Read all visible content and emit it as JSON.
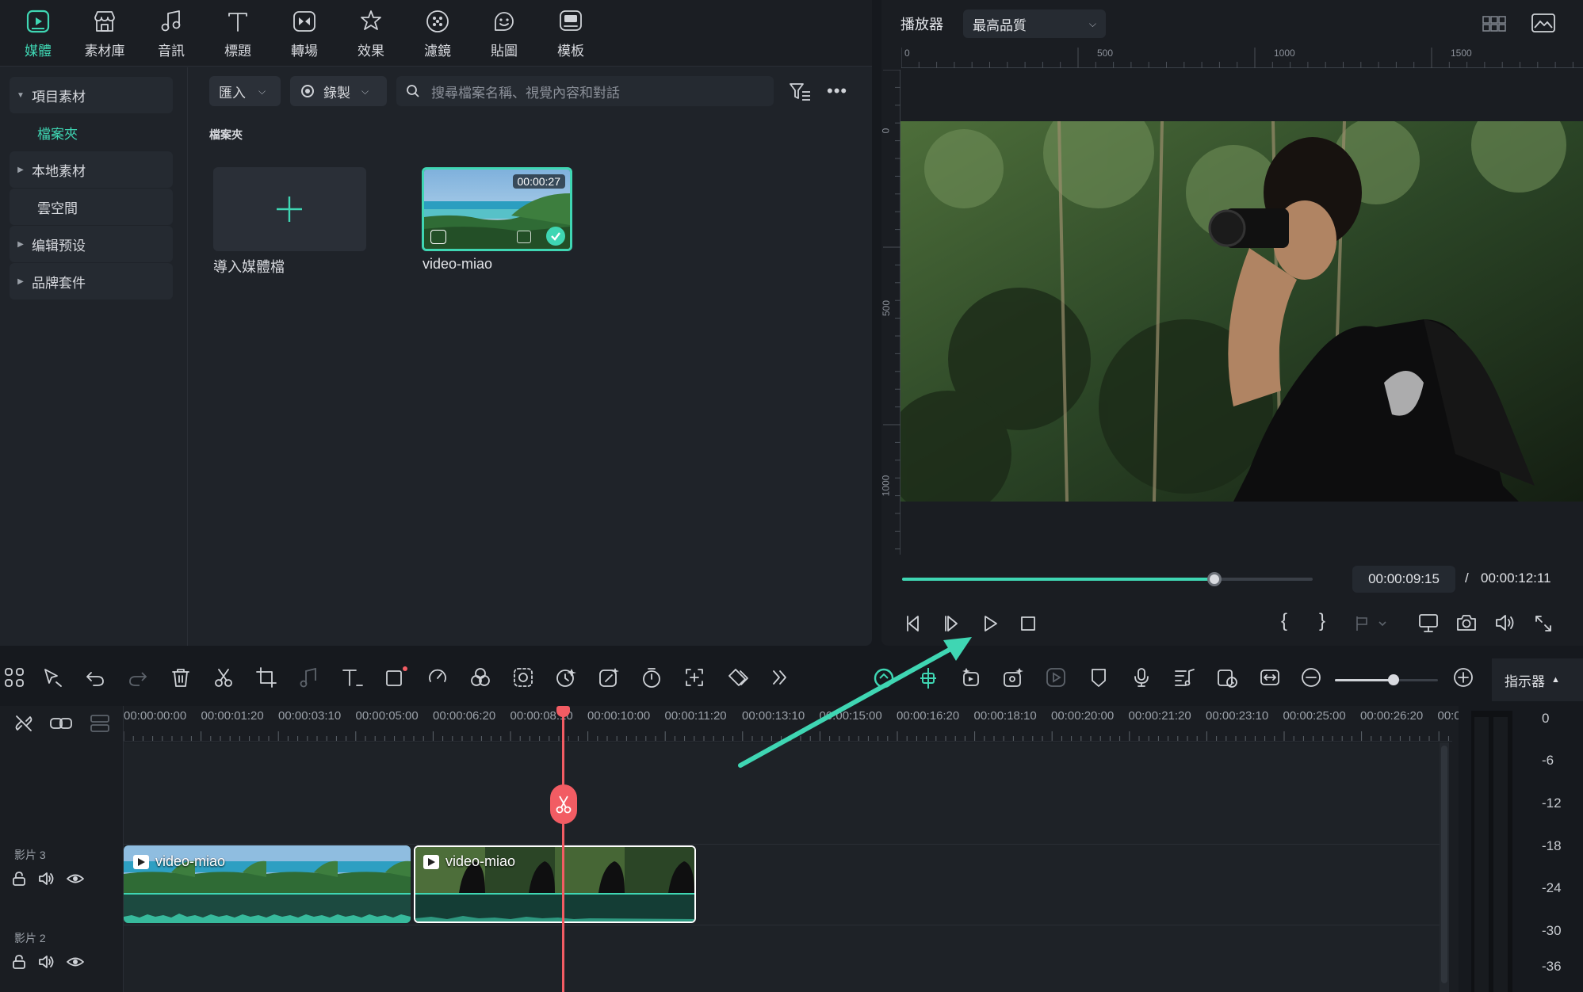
{
  "toolbar": {
    "tabs": [
      {
        "label": "媒體",
        "icon": "media-icon",
        "active": true
      },
      {
        "label": "素材庫",
        "icon": "store-icon"
      },
      {
        "label": "音訊",
        "icon": "music-icon"
      },
      {
        "label": "標題",
        "icon": "text-icon"
      },
      {
        "label": "轉場",
        "icon": "transition-icon"
      },
      {
        "label": "效果",
        "icon": "effects-icon"
      },
      {
        "label": "濾鏡",
        "icon": "filter-icon"
      },
      {
        "label": "貼圖",
        "icon": "sticker-icon"
      },
      {
        "label": "模板",
        "icon": "template-icon"
      }
    ]
  },
  "sidebar": {
    "items": [
      {
        "label": "項目素材",
        "expanded": true
      },
      {
        "label": "檔案夾",
        "selected": true
      },
      {
        "label": "本地素材"
      },
      {
        "label": "雲空間"
      },
      {
        "label": "编辑预设"
      },
      {
        "label": "品牌套件"
      }
    ]
  },
  "library": {
    "import_label": "匯入",
    "record_label": "錄製",
    "search_placeholder": "搜尋檔案名稱、視覺內容和對話",
    "folder_heading": "檔案夾",
    "import_tile_label": "導入媒體檔",
    "media_items": [
      {
        "name": "video-miao",
        "duration": "00:00:27"
      }
    ]
  },
  "player": {
    "title": "播放器",
    "quality": "最高品質",
    "ruler_h": [
      "0",
      "500",
      "1000",
      "1500"
    ],
    "ruler_v": [
      "0",
      "500",
      "1000"
    ],
    "current_time": "00:00:09:15",
    "separator": "/",
    "total_time": "00:00:12:11",
    "progress": 0.76
  },
  "timeline": {
    "indicator_label": "指示器",
    "ruler_labels": [
      "00:00:00:00",
      "00:00:01:20",
      "00:00:03:10",
      "00:00:05:00",
      "00:00:06:20",
      "00:00:08:10",
      "00:00:10:00",
      "00:00:11:20",
      "00:00:13:10",
      "00:00:15:00",
      "00:00:16:20",
      "00:00:18:10",
      "00:00:20:00",
      "00:00:21:20",
      "00:00:23:10",
      "00:00:25:00",
      "00:00:26:20",
      "00:0"
    ],
    "tracks": [
      {
        "label": "影片 3"
      },
      {
        "label": "影片 2"
      }
    ],
    "clips": [
      {
        "name": "video-miao",
        "type": "beach"
      },
      {
        "name": "video-miao",
        "type": "forest",
        "selected": true
      }
    ],
    "meter_labels": [
      "0",
      "-6",
      "-12",
      "-18",
      "-24",
      "-30",
      "-36"
    ]
  },
  "colors": {
    "accent": "#3fd6b3",
    "playhead": "#f25c63"
  }
}
